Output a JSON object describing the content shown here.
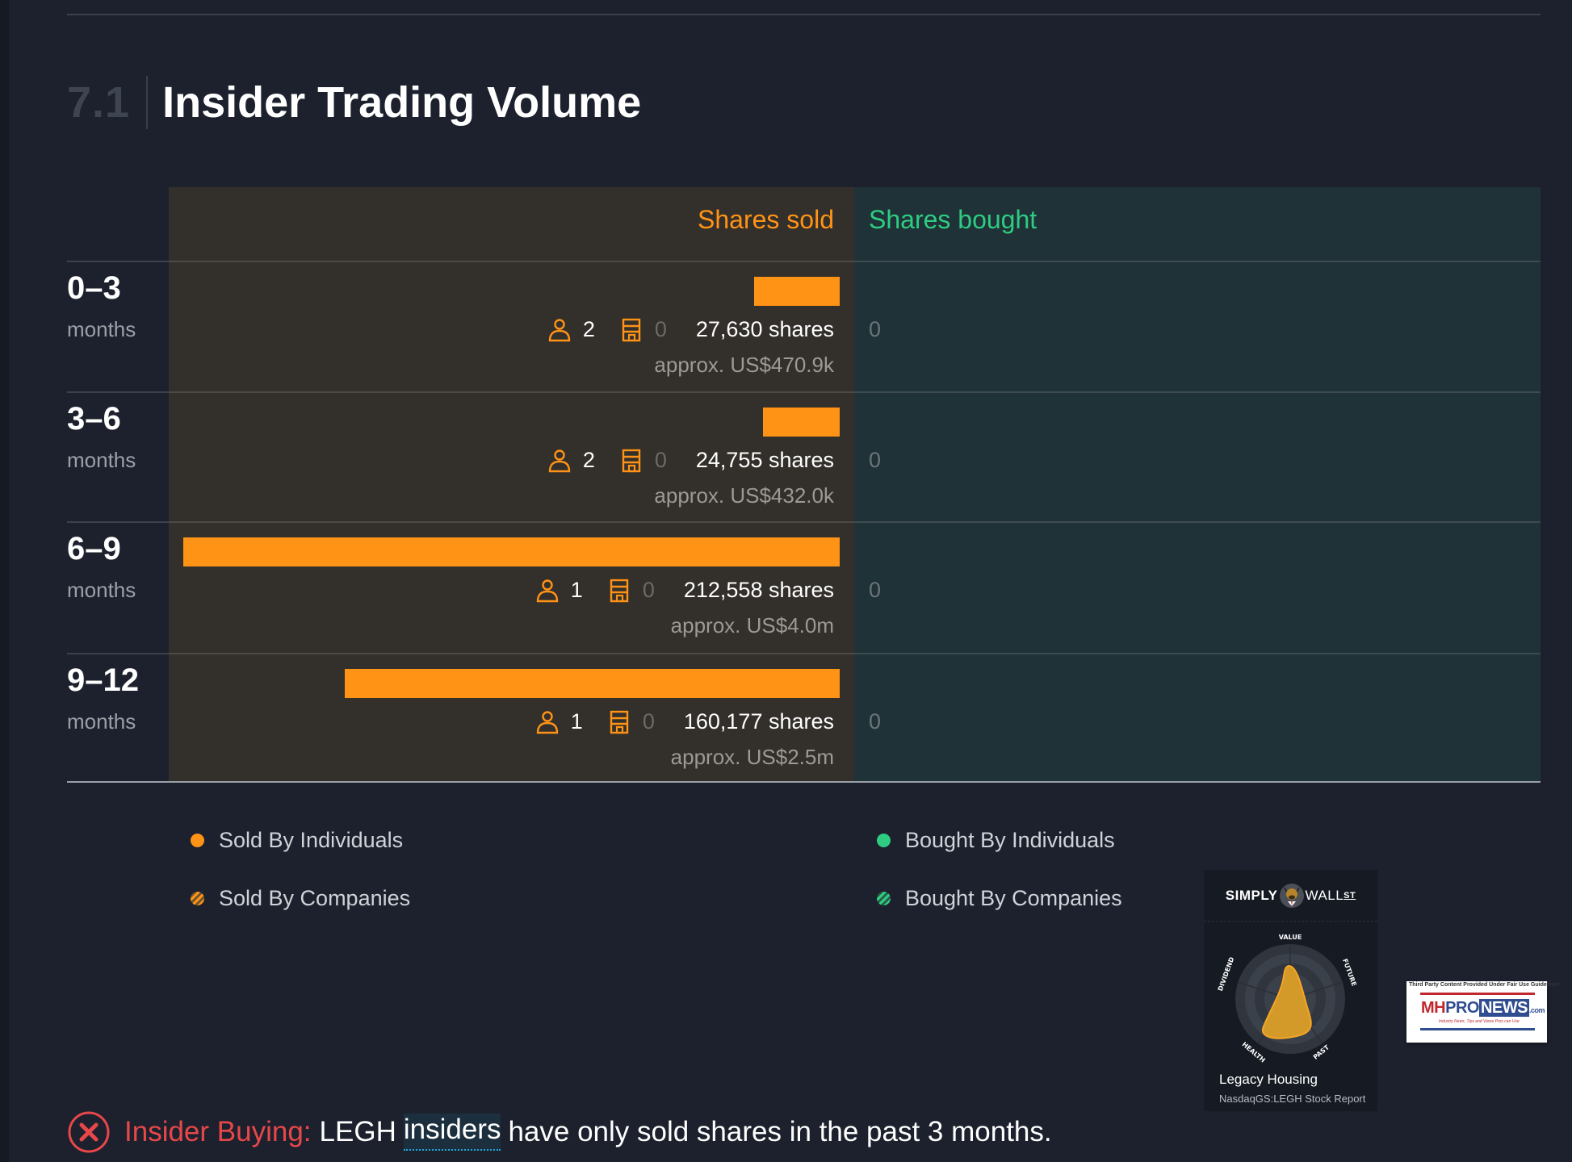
{
  "section": {
    "number": "7.1",
    "title": "Insider Trading Volume"
  },
  "table": {
    "header_sold": "Shares sold",
    "header_bought": "Shares bought",
    "rows": [
      {
        "range": "0–3",
        "unit": "months",
        "sold_shares": 27630,
        "sold_label": "27,630 shares",
        "individuals": "2",
        "companies": "0",
        "approx": "approx. US$470.9k",
        "bought": "0"
      },
      {
        "range": "3–6",
        "unit": "months",
        "sold_shares": 24755,
        "sold_label": "24,755 shares",
        "individuals": "2",
        "companies": "0",
        "approx": "approx. US$432.0k",
        "bought": "0"
      },
      {
        "range": "6–9",
        "unit": "months",
        "sold_shares": 212558,
        "sold_label": "212,558 shares",
        "individuals": "1",
        "companies": "0",
        "approx": "approx. US$4.0m",
        "bought": "0"
      },
      {
        "range": "9–12",
        "unit": "months",
        "sold_shares": 160177,
        "sold_label": "160,177 shares",
        "individuals": "1",
        "companies": "0",
        "approx": "approx. US$2.5m",
        "bought": "0"
      }
    ]
  },
  "chart_data": {
    "type": "bar",
    "title": "Insider Trading Volume",
    "categories": [
      "0–3 months",
      "3–6 months",
      "6–9 months",
      "9–12 months"
    ],
    "series": [
      {
        "name": "Shares sold",
        "values": [
          27630,
          24755,
          212558,
          160177
        ]
      },
      {
        "name": "Shares bought",
        "values": [
          0,
          0,
          0,
          0
        ]
      }
    ],
    "orientation": "horizontal",
    "legend": [
      "Sold By Individuals",
      "Sold By Companies",
      "Bought By Individuals",
      "Bought By Companies"
    ]
  },
  "legend": {
    "sold_individuals": "Sold By Individuals",
    "sold_companies": "Sold By Companies",
    "bought_individuals": "Bought By Individuals",
    "bought_companies": "Bought By Companies"
  },
  "colors": {
    "sold": "#ff9316",
    "bought": "#2ecc82",
    "negative": "#e8474a"
  },
  "sws_card": {
    "brand_left": "SIMPLY",
    "brand_right": "WALL",
    "brand_st": "ST",
    "axes": [
      "VALUE",
      "FUTURE",
      "PAST",
      "HEALTH",
      "DIVIDEND"
    ],
    "company": "Legacy Housing",
    "report": "NasdaqGS:LEGH Stock Report"
  },
  "mh_logo": {
    "fair_use": "Third Party Content Provided Under Fair Use Guidelines",
    "mh": "MH",
    "pro": "PRO",
    "news": "NEWS",
    "com": ".com",
    "tagline": "Industry News, Tips and Views Pros can Use"
  },
  "insight": {
    "label": "Insider Buying:",
    "prefix": "LEGH",
    "link": "insiders",
    "suffix": "have only sold shares in the past 3 months."
  }
}
